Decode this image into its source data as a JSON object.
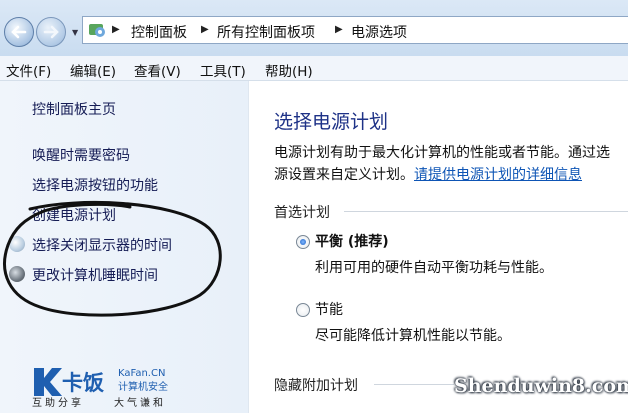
{
  "breadcrumb": [
    "控制面板",
    "所有控制面板项",
    "电源选项"
  ],
  "menu": [
    "文件(F)",
    "编辑(E)",
    "查看(V)",
    "工具(T)",
    "帮助(H)"
  ],
  "sidebar": {
    "home": "控制面板主页",
    "links": [
      "唤醒时需要密码",
      "选择电源按钮的功能",
      "创建电源计划",
      "选择关闭显示器的时间",
      "更改计算机睡眠时间"
    ]
  },
  "content": {
    "title": "选择电源计划",
    "desc_line1": "电源计划有助于最大化计算机的性能或者节能。通过选",
    "desc_line2_prefix": "源设置来自定义计划。",
    "desc_link": "请提供电源计划的详细信息",
    "preferred_label": "首选计划",
    "plans": [
      {
        "name": "平衡 (推荐)",
        "desc": "利用可用的硬件自动平衡功耗与性能。",
        "selected": true
      },
      {
        "name": "节能",
        "desc": "尽可能降低计算机性能以节能。",
        "selected": false
      }
    ],
    "hidden_label": "隐藏附加计划"
  },
  "logo": {
    "brand": "卡饭",
    "sub1": "KaFan.CN",
    "sub2": "计算机安全",
    "tagline1": "互助分享",
    "tagline2": "大气谦和"
  },
  "watermark": "Shenduwin8.com"
}
